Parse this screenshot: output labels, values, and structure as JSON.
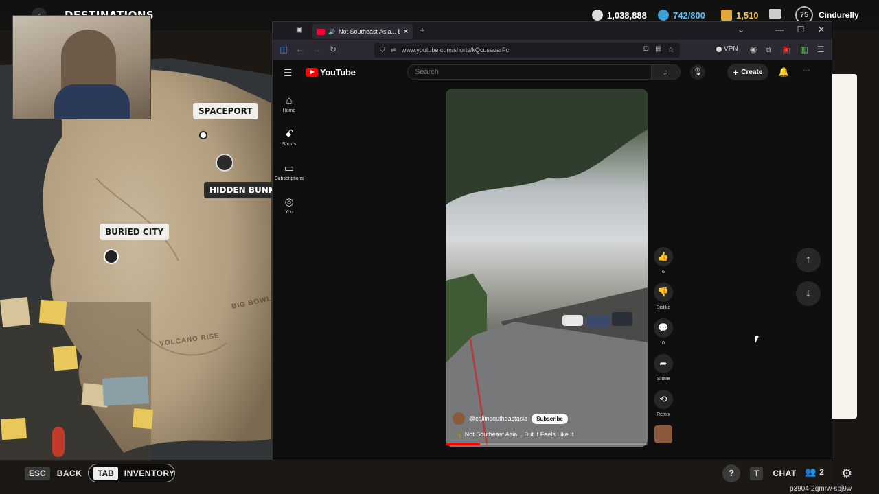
{
  "game": {
    "title": "DESTINATIONS",
    "stats": [
      {
        "icon": "coin-icon",
        "value": "1,038,888",
        "color": "#dddddd"
      },
      {
        "icon": "token-icon",
        "value": "742/800",
        "color": "#3aa0d8"
      },
      {
        "icon": "bars-icon",
        "value": "1,510",
        "color": "#e0a83a"
      }
    ],
    "level": "75",
    "username": "Cindurelly",
    "locations": {
      "spaceport": "SPACEPORT",
      "hidden_bunker": "HIDDEN BUNKE",
      "buried_city": "BURIED CITY",
      "big_bowl": "BIG BOWL",
      "volcano_rise": "VOLCANO RISE"
    },
    "bottom": {
      "esc_key": "ESC",
      "back_label": "BACK",
      "tab_key": "TAB",
      "inventory_label": "INVENTORY",
      "help": "?",
      "t_key": "T",
      "chat_label": "CHAT",
      "party_count": "2"
    },
    "session_id": "p3904-2qmrw-spj9w"
  },
  "browser": {
    "tab_title": "Not Southeast Asia... Bu",
    "url": "www.youtube.com/shorts/kQcusaoarFc",
    "vpn_label": "VPN"
  },
  "youtube": {
    "logo_text": "YouTube",
    "search_placeholder": "Search",
    "create_label": "Create",
    "sidebar": [
      {
        "icon": "home-icon",
        "label": "Home"
      },
      {
        "icon": "shorts-icon",
        "label": "Shorts"
      },
      {
        "icon": "subscriptions-icon",
        "label": "Subscriptions"
      },
      {
        "icon": "you-icon",
        "label": "You"
      }
    ],
    "short": {
      "channel": "@caliinsoutheastasia",
      "subscribe_label": "Subscribe",
      "title": "Not Southeast Asia... But It Feels Like It",
      "progress": 0.17
    },
    "actions": {
      "like_count": "6",
      "dislike_label": "Dislike",
      "comment_count": "0",
      "share_label": "Share",
      "remix_label": "Remix"
    }
  }
}
